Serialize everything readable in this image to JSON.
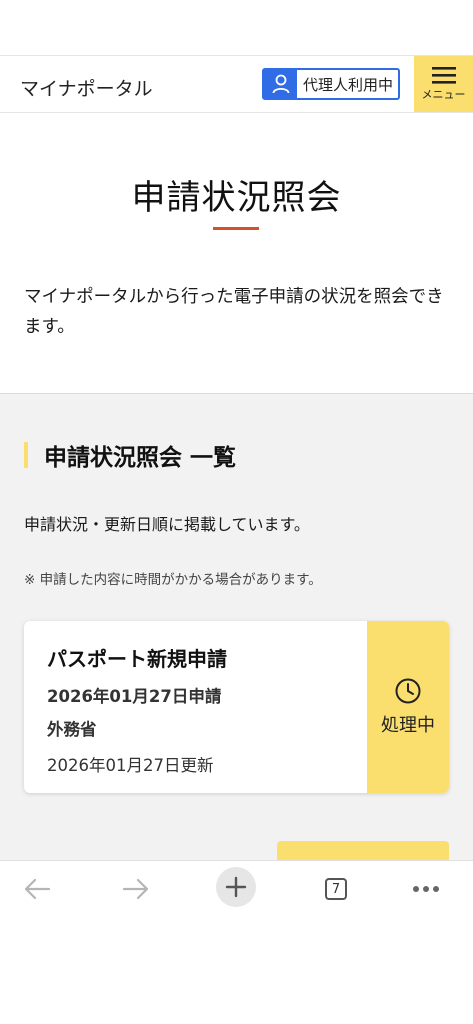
{
  "header": {
    "site_name": "マイナポータル",
    "proxy_label": "代理人利用中",
    "menu_label": "メニュー"
  },
  "title": {
    "text": "申請状況照会"
  },
  "intro": {
    "text": "マイナポータルから行った電子申請の状況を照会できます。"
  },
  "list_section": {
    "heading": "申請状況照会 一覧",
    "order_note": "申請状況・更新日順に掲載しています。",
    "warn_note": "※ 申請した内容に時間がかかる場合があります。"
  },
  "applications": [
    {
      "title": "パスポート新規申請",
      "applied_date": "2026年01月27日申請",
      "ministry": "外務省",
      "updated_date": "2026年01月27日更新",
      "status": "処理中"
    }
  ],
  "browser_bar": {
    "tab_count": "7"
  },
  "colors": {
    "accent_yellow": "#fadf6f",
    "accent_blue": "#2f6ce5",
    "underline_red": "#d8502a"
  }
}
